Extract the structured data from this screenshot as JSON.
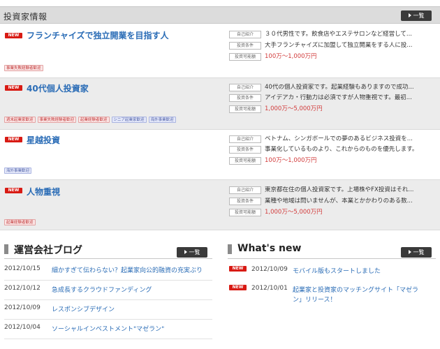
{
  "header": {
    "title": "投資家情報",
    "more_label": "一覧"
  },
  "investors": [
    {
      "badge": "NEW",
      "title": "フランチャイズで独立開業を目指す人",
      "tags": [
        {
          "label": "事業失敗経験者歓迎",
          "color": "red"
        }
      ],
      "info": [
        {
          "label": "自己紹介",
          "text": "３０代男性です。飲食店やエステサロンなど経営して..."
        },
        {
          "label": "投資条件",
          "text": "大手フランチャイズに加盟して独立開業をする人に投..."
        },
        {
          "label": "投資可能額",
          "text": "100万～1,000万円"
        }
      ]
    },
    {
      "badge": "NEW",
      "title": "40代個人投資家",
      "tags": [
        {
          "label": "週末起業家歓迎",
          "color": "red"
        },
        {
          "label": "事業失敗経験者歓迎",
          "color": "red"
        },
        {
          "label": "起業経験者歓迎",
          "color": "red"
        },
        {
          "label": "シニア起業家歓迎",
          "color": "blue"
        },
        {
          "label": "海外事業歓迎",
          "color": "blue"
        }
      ],
      "info": [
        {
          "label": "自己紹介",
          "text": "40代の個人投資家です。起業経験もありますので成功..."
        },
        {
          "label": "投資条件",
          "text": "アイデアカ・行動力は必須ですが人物重視です。最初..."
        },
        {
          "label": "投資可能額",
          "text": "1,000万～5,000万円"
        }
      ]
    },
    {
      "badge": "NEW",
      "title": "星越投資",
      "tags": [
        {
          "label": "海外事業歓迎",
          "color": "blue"
        }
      ],
      "info": [
        {
          "label": "自己紹介",
          "text": "ベトナム、シンガポールでの夢のあるビジネス投資を..."
        },
        {
          "label": "投資条件",
          "text": "事業化しているものより、これからのものを優先します。"
        },
        {
          "label": "投資可能額",
          "text": "100万～1,000万円"
        }
      ]
    },
    {
      "badge": "NEW",
      "title": "人物重視",
      "tags": [
        {
          "label": "起業経験者歓迎",
          "color": "red"
        }
      ],
      "info": [
        {
          "label": "自己紹介",
          "text": "東京都在住の個人投資家です。上場株やFX投資はそれ..."
        },
        {
          "label": "投資条件",
          "text": "業種や地域は問いませんが、本業とかかわりのある数..."
        },
        {
          "label": "投資可能額",
          "text": "1,000万～5,000万円"
        }
      ]
    }
  ],
  "blog": {
    "title": "運営会社ブログ",
    "more_label": "一覧",
    "entries": [
      {
        "date": "2012/10/15",
        "text": "細かすぎて伝わらない？起業家向公的融資の充実ぶり"
      },
      {
        "date": "2012/10/12",
        "text": "急成長するクラウドファンディング"
      },
      {
        "date": "2012/10/09",
        "text": "レスポンシブデザイン"
      },
      {
        "date": "2012/10/04",
        "text": "ソーシャルインベストメント\"マゼラン\""
      }
    ]
  },
  "news": {
    "title": "What's new",
    "more_label": "一覧",
    "entries": [
      {
        "badge": "NEW",
        "date": "2012/10/09",
        "line1": "モバイル版もスタートしました",
        "line2": ""
      },
      {
        "badge": "NEW",
        "date": "2012/10/01",
        "line1": "起業家と投資家のマッチングサイト「マゼラ",
        "line2": "ン」リリース！"
      }
    ]
  },
  "colors": {
    "link": "#2a6cb6",
    "badge": "#d81b14",
    "amount": "#d23c3c",
    "button": "#3a3a3a"
  }
}
